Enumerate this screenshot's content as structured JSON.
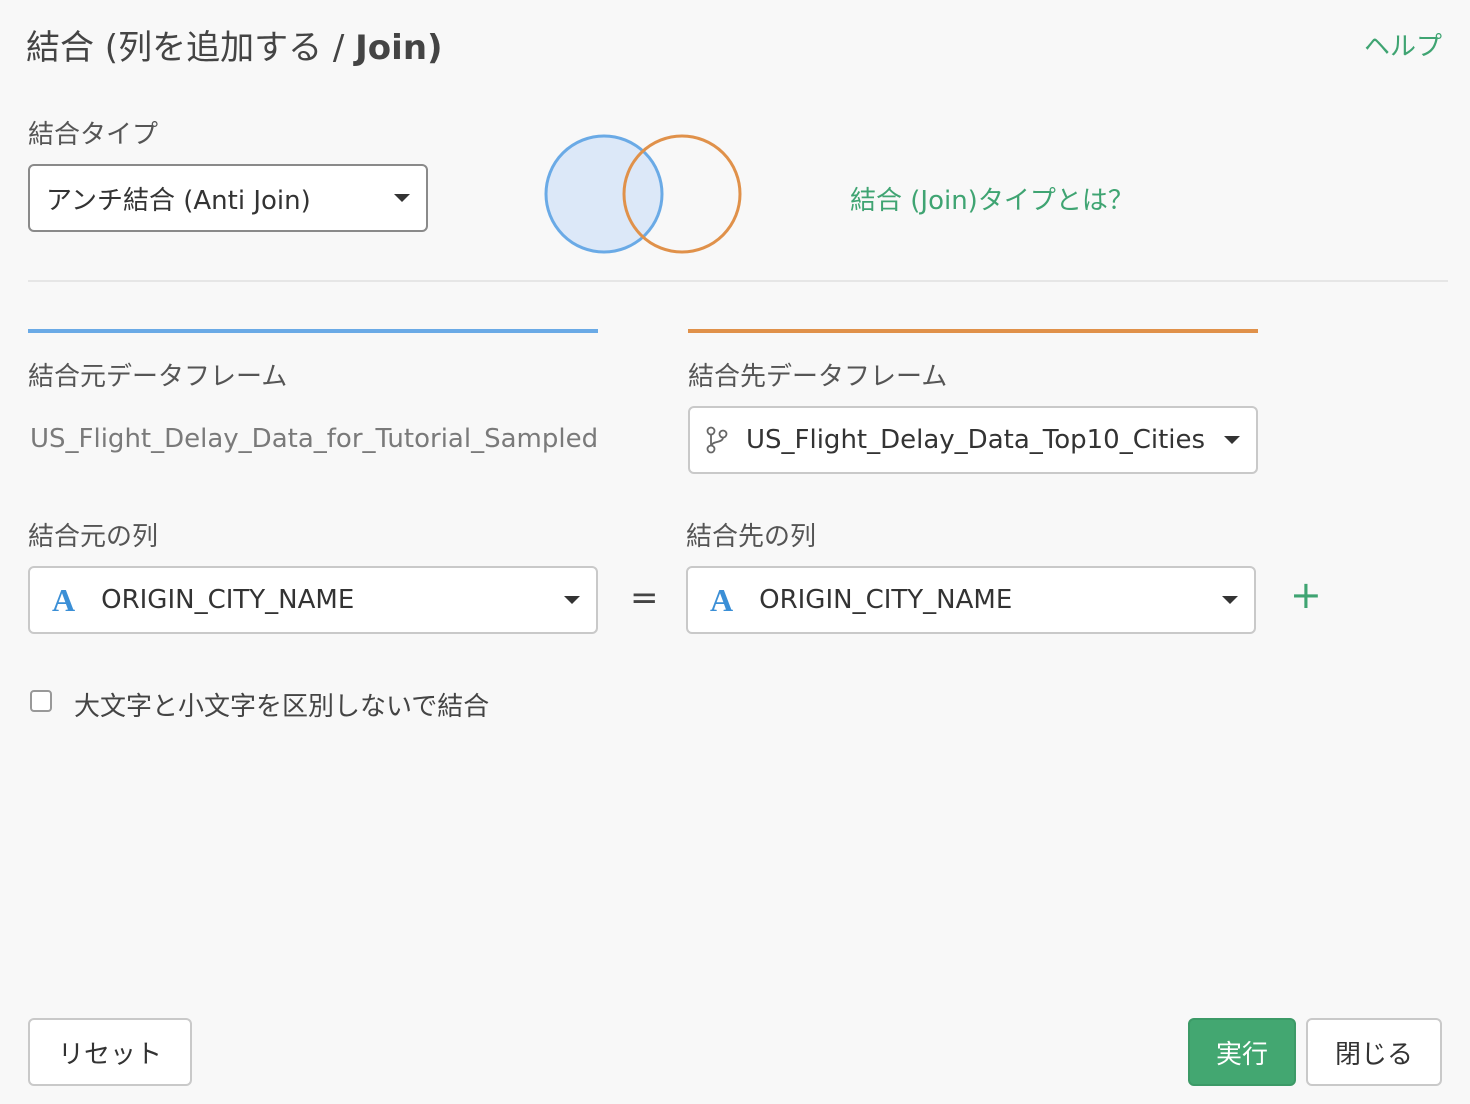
{
  "dialog": {
    "title_prefix": "結合 (列を追加する / ",
    "title_suffix": "Join)",
    "help_label": "ヘルプ"
  },
  "join_type": {
    "label": "結合タイプ",
    "selected": "アンチ結合 (Anti Join)",
    "what_is_link": "結合 (Join)タイプとは？",
    "venn_left_color": "#6aaae6",
    "venn_right_color": "#e0914a",
    "venn_fill": "#dce8f8"
  },
  "source": {
    "label": "結合元データフレーム",
    "dataframe": "US_Flight_Delay_Data_for_Tutorial_Sampled",
    "column_label": "結合元の列",
    "column_type_icon": "A",
    "column_value": "ORIGIN_CITY_NAME",
    "accent": "#6aaae6"
  },
  "target": {
    "label": "結合先データフレーム",
    "dataframe_icon": "branch-icon",
    "dataframe": "US_Flight_Delay_Data_Top10_Cities",
    "column_label": "結合先の列",
    "column_type_icon": "A",
    "column_value": "ORIGIN_CITY_NAME",
    "accent": "#e0914a"
  },
  "equals_sign": "=",
  "add_condition": "+",
  "case_insensitive": {
    "checked": false,
    "label": "大文字と小文字を区別しないで結合"
  },
  "footer": {
    "reset_label": "リセット",
    "run_label": "実行",
    "close_label": "閉じる",
    "primary_color": "#43a771"
  }
}
